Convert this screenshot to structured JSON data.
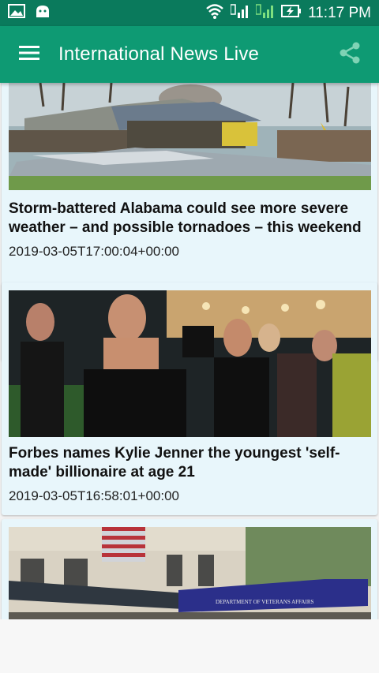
{
  "status_bar": {
    "time": "11:17 PM",
    "icons": [
      "photo-icon",
      "android-icon",
      "wifi-icon",
      "sim1-signal-icon",
      "sim2-signal-icon",
      "battery-charging-icon"
    ]
  },
  "app_bar": {
    "title": "International News Live",
    "menu_icon": "hamburger-menu-icon",
    "share_icon": "share-icon",
    "color": "#0e9a73"
  },
  "articles": [
    {
      "headline": "Storm-battered Alabama could see more severe weather – and possible tornadoes – this weekend",
      "date": "2019-03-05T17:00:04+00:00",
      "image": "storm-damaged barn photo"
    },
    {
      "headline": "Forbes names Kylie Jenner the youngest 'self-made' billionaire at age 21",
      "date": "2019-03-05T16:58:01+00:00",
      "image": "red carpet photo"
    },
    {
      "headline": "",
      "date": "",
      "image": "Department of Veterans Affairs building photo",
      "image_text": "DEPARTMENT OF VETERANS AFFAIRS"
    }
  ]
}
